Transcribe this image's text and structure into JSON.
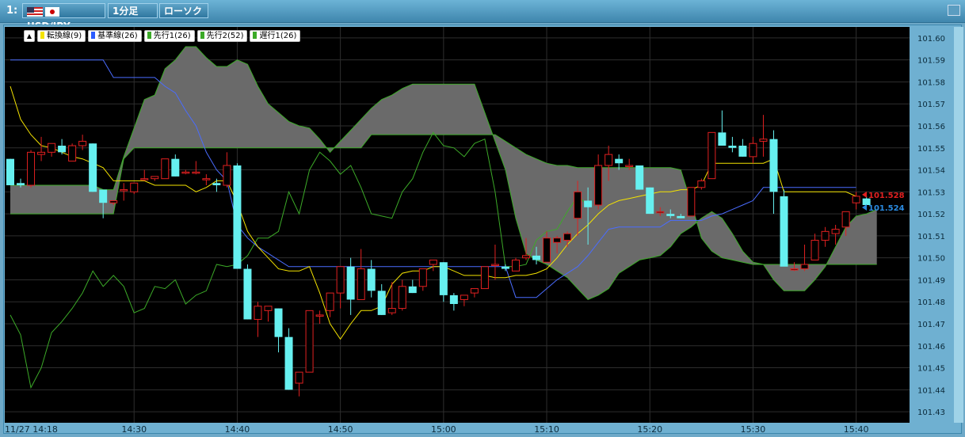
{
  "window": {
    "number": "1:",
    "pair": "USD/JPY",
    "timeframe": "1分足",
    "chart_type": "ローソク"
  },
  "legend": {
    "toggle": "▲",
    "items": [
      {
        "label": "転換線(9)",
        "color": "#f4e300"
      },
      {
        "label": "基準線(26)",
        "color": "#2b5cff"
      },
      {
        "label": "先行1(26)",
        "color": "#3caa28"
      },
      {
        "label": "先行2(52)",
        "color": "#3caa28"
      },
      {
        "label": "遅行1(26)",
        "color": "#3caa28"
      }
    ]
  },
  "chart_data": {
    "type": "candlestick",
    "title": "",
    "ylim": [
      101.425,
      101.605
    ],
    "y_ticks": [
      "101.60",
      "101.59",
      "101.58",
      "101.57",
      "101.56",
      "101.55",
      "101.54",
      "101.53",
      "101.52",
      "101.51",
      "101.50",
      "101.49",
      "101.48",
      "101.47",
      "101.46",
      "101.45",
      "101.44",
      "101.43"
    ],
    "x_ticks": [
      {
        "label": "11/27 14:18",
        "index": 0
      },
      {
        "label": "14:30",
        "index": 12
      },
      {
        "label": "14:40",
        "index": 22
      },
      {
        "label": "14:50",
        "index": 32
      },
      {
        "label": "15:00",
        "index": 42
      },
      {
        "label": "15:10",
        "index": 52
      },
      {
        "label": "15:20",
        "index": 62
      },
      {
        "label": "15:30",
        "index": 72
      },
      {
        "label": "15:40",
        "index": 82
      }
    ],
    "colors": {
      "background": "#000000",
      "grid": "#2e2e2e",
      "bull": "#e02020",
      "bear": "#66f0f0",
      "cloud": "#6a6a6a"
    },
    "price_labels": [
      {
        "value": 101.528,
        "text": "101.528",
        "color": "#e02020"
      },
      {
        "value": 101.524,
        "text": "101.524",
        "color": "#2a8ae0"
      }
    ],
    "candles": [
      [
        101.545,
        101.545,
        101.533,
        101.533
      ],
      [
        101.534,
        101.536,
        101.532,
        101.533
      ],
      [
        101.533,
        101.549,
        101.532,
        101.548
      ],
      [
        101.547,
        101.555,
        101.544,
        101.548
      ],
      [
        101.548,
        101.552,
        101.546,
        101.552
      ],
      [
        101.551,
        101.554,
        101.547,
        101.548
      ],
      [
        101.544,
        101.552,
        101.544,
        101.551
      ],
      [
        101.551,
        101.556,
        101.549,
        101.553
      ],
      [
        101.552,
        101.552,
        101.53,
        101.53
      ],
      [
        101.531,
        101.531,
        101.518,
        101.525
      ],
      [
        101.525,
        101.526,
        101.524,
        101.526
      ],
      [
        101.531,
        101.534,
        101.526,
        101.531
      ],
      [
        101.53,
        101.534,
        101.529,
        101.534
      ],
      [
        101.536,
        101.54,
        101.535,
        101.536
      ],
      [
        101.536,
        101.537,
        101.535,
        101.537
      ],
      [
        101.536,
        101.545,
        101.536,
        101.545
      ],
      [
        101.545,
        101.547,
        101.537,
        101.537
      ],
      [
        101.539,
        101.54,
        101.538,
        101.539
      ],
      [
        101.539,
        101.544,
        101.538,
        101.539
      ],
      [
        101.536,
        101.538,
        101.533,
        101.536
      ],
      [
        101.534,
        101.536,
        101.53,
        101.533
      ],
      [
        101.533,
        101.548,
        101.532,
        101.542
      ],
      [
        101.542,
        101.543,
        101.495,
        101.495
      ],
      [
        101.495,
        101.497,
        101.472,
        101.472
      ],
      [
        101.472,
        101.48,
        101.464,
        101.478
      ],
      [
        101.476,
        101.478,
        101.471,
        101.478
      ],
      [
        101.477,
        101.477,
        101.457,
        101.464
      ],
      [
        101.464,
        101.468,
        101.44,
        101.44
      ],
      [
        101.443,
        101.446,
        101.437,
        101.448
      ],
      [
        101.448,
        101.452,
        101.448,
        101.476
      ],
      [
        101.474,
        101.476,
        101.47,
        101.474
      ],
      [
        101.476,
        101.482,
        101.473,
        101.484
      ],
      [
        101.484,
        101.496,
        101.477,
        101.496
      ],
      [
        101.496,
        101.5,
        101.474,
        101.481
      ],
      [
        101.481,
        101.504,
        101.481,
        101.495
      ],
      [
        101.495,
        101.499,
        101.482,
        101.485
      ],
      [
        101.485,
        101.488,
        101.474,
        101.474
      ],
      [
        101.475,
        101.489,
        101.474,
        101.477
      ],
      [
        101.477,
        101.49,
        101.476,
        101.487
      ],
      [
        101.487,
        101.49,
        101.484,
        101.484
      ],
      [
        101.487,
        101.492,
        101.485,
        101.495
      ],
      [
        101.497,
        101.499,
        101.494,
        101.499
      ],
      [
        101.498,
        101.498,
        101.48,
        101.483
      ],
      [
        101.483,
        101.484,
        101.476,
        101.479
      ],
      [
        101.481,
        101.482,
        101.478,
        101.483
      ],
      [
        101.484,
        101.486,
        101.482,
        101.486
      ],
      [
        101.486,
        101.486,
        101.496,
        101.496
      ],
      [
        101.497,
        101.506,
        101.49,
        101.497
      ],
      [
        101.496,
        101.497,
        101.494,
        101.495
      ],
      [
        101.494,
        101.5,
        101.494,
        101.499
      ],
      [
        101.5,
        101.509,
        101.499,
        101.501
      ],
      [
        101.501,
        101.505,
        101.497,
        101.499
      ],
      [
        101.498,
        101.512,
        101.499,
        101.509
      ],
      [
        101.507,
        101.51,
        101.502,
        101.509
      ],
      [
        101.508,
        101.512,
        101.505,
        101.511
      ],
      [
        101.518,
        101.535,
        101.51,
        101.53
      ],
      [
        101.526,
        101.532,
        101.506,
        101.523
      ],
      [
        101.524,
        101.547,
        101.522,
        101.542
      ],
      [
        101.542,
        101.551,
        101.535,
        101.547
      ],
      [
        101.545,
        101.547,
        101.54,
        101.543
      ],
      [
        101.542,
        101.545,
        101.54,
        101.542
      ],
      [
        101.542,
        101.542,
        101.531,
        101.531
      ],
      [
        101.532,
        101.532,
        101.52,
        101.52
      ],
      [
        101.521,
        101.523,
        101.519,
        101.521
      ],
      [
        101.52,
        101.522,
        101.518,
        101.519
      ],
      [
        101.519,
        101.52,
        101.518,
        101.518
      ],
      [
        101.519,
        101.532,
        101.519,
        101.532
      ],
      [
        101.532,
        101.536,
        101.531,
        101.535
      ],
      [
        101.536,
        101.548,
        101.536,
        101.557
      ],
      [
        101.557,
        101.567,
        101.557,
        101.551
      ],
      [
        101.551,
        101.555,
        101.548,
        101.55
      ],
      [
        101.551,
        101.554,
        101.546,
        101.546
      ],
      [
        101.546,
        101.555,
        101.543,
        101.552
      ],
      [
        101.553,
        101.565,
        101.546,
        101.554
      ],
      [
        101.554,
        101.558,
        101.52,
        101.53
      ],
      [
        101.528,
        101.531,
        101.503,
        101.496
      ],
      [
        101.495,
        101.498,
        101.494,
        101.495
      ],
      [
        101.495,
        101.506,
        101.494,
        101.497
      ],
      [
        101.499,
        101.511,
        101.499,
        101.508
      ],
      [
        101.508,
        101.514,
        101.505,
        101.512
      ],
      [
        101.511,
        101.515,
        101.506,
        101.513
      ],
      [
        101.514,
        101.519,
        101.51,
        101.521
      ],
      [
        101.525,
        101.53,
        101.522,
        101.528
      ],
      [
        101.527,
        101.528,
        101.524,
        101.524
      ]
    ],
    "tenkan": [
      101.578,
      101.563,
      101.556,
      101.551,
      101.55,
      101.548,
      101.546,
      101.545,
      101.543,
      101.541,
      101.535,
      101.535,
      101.535,
      101.535,
      101.533,
      101.533,
      101.533,
      101.533,
      101.53,
      101.532,
      101.535,
      101.535,
      101.525,
      101.512,
      101.505,
      101.5,
      101.495,
      101.494,
      101.494,
      101.496,
      101.484,
      101.47,
      101.463,
      101.47,
      101.476,
      101.476,
      101.478,
      101.488,
      101.493,
      101.494,
      101.494,
      101.496,
      101.496,
      101.494,
      101.492,
      101.492,
      101.492,
      101.491,
      101.491,
      101.492,
      101.492,
      101.493,
      101.495,
      101.5,
      101.506,
      101.511,
      101.515,
      101.52,
      101.524,
      101.526,
      101.527,
      101.528,
      101.529,
      101.53,
      101.53,
      101.531,
      101.531,
      101.533,
      101.543,
      101.543,
      101.543,
      101.543,
      101.543,
      101.543,
      101.545,
      101.53,
      101.53,
      101.53,
      101.53,
      101.53,
      101.53,
      101.53,
      101.528
    ],
    "kijun": [
      101.59,
      101.59,
      101.59,
      101.59,
      101.59,
      101.59,
      101.59,
      101.59,
      101.59,
      101.59,
      101.582,
      101.582,
      101.582,
      101.582,
      101.582,
      101.578,
      101.575,
      101.567,
      101.56,
      101.548,
      101.54,
      101.535,
      101.515,
      101.509,
      101.505,
      101.502,
      101.499,
      101.496,
      101.496,
      101.496,
      101.496,
      101.496,
      101.496,
      101.496,
      101.496,
      101.496,
      101.496,
      101.496,
      101.496,
      101.496,
      101.496,
      101.496,
      101.496,
      101.496,
      101.496,
      101.496,
      101.496,
      101.496,
      101.496,
      101.482,
      101.482,
      101.482,
      101.486,
      101.49,
      101.493,
      101.496,
      101.501,
      101.507,
      101.513,
      101.514,
      101.514,
      101.514,
      101.514,
      101.514,
      101.517,
      101.517,
      101.517,
      101.517,
      101.519,
      101.52,
      101.522,
      101.524,
      101.526,
      101.532,
      101.532,
      101.532,
      101.532,
      101.532,
      101.532,
      101.532,
      101.532,
      101.532,
      101.532
    ],
    "senkou1": [
      101.533,
      101.533,
      101.533,
      101.533,
      101.533,
      101.533,
      101.533,
      101.533,
      101.533,
      101.531,
      101.531,
      101.546,
      101.559,
      101.572,
      101.574,
      101.586,
      101.59,
      101.596,
      101.596,
      101.591,
      101.587,
      101.587,
      101.59,
      101.588,
      101.578,
      101.57,
      101.566,
      101.562,
      101.56,
      101.559,
      101.554,
      101.548,
      101.553,
      101.558,
      101.563,
      101.568,
      101.572,
      101.574,
      101.577,
      101.579,
      101.579,
      101.579,
      101.579,
      101.579,
      101.579,
      101.579,
      101.566,
      101.553,
      101.54,
      101.518,
      101.502,
      101.499,
      101.497,
      101.494,
      101.491,
      101.486,
      101.481,
      101.483,
      101.486,
      101.493,
      101.496,
      101.499,
      101.5,
      101.501,
      101.505,
      101.511,
      101.514,
      101.518,
      101.521,
      101.518,
      101.511,
      101.503,
      101.498,
      101.497,
      101.49,
      101.485,
      101.485,
      101.485,
      101.49,
      101.496,
      101.505,
      101.514,
      101.519,
      101.52,
      101.522
    ],
    "senkou2": [
      101.52,
      101.52,
      101.52,
      101.52,
      101.52,
      101.52,
      101.52,
      101.52,
      101.52,
      101.52,
      101.52,
      101.545,
      101.55,
      101.55,
      101.55,
      101.55,
      101.55,
      101.55,
      101.55,
      101.55,
      101.55,
      101.55,
      101.55,
      101.55,
      101.55,
      101.55,
      101.55,
      101.55,
      101.55,
      101.55,
      101.55,
      101.55,
      101.55,
      101.55,
      101.55,
      101.556,
      101.556,
      101.556,
      101.556,
      101.556,
      101.556,
      101.556,
      101.556,
      101.556,
      101.556,
      101.556,
      101.556,
      101.556,
      101.553,
      101.55,
      101.547,
      101.545,
      101.543,
      101.542,
      101.542,
      101.541,
      101.541,
      101.541,
      101.541,
      101.541,
      101.541,
      101.541,
      101.541,
      101.541,
      101.541,
      101.54,
      101.525,
      101.509,
      101.503,
      101.5,
      101.499,
      101.498,
      101.497,
      101.497,
      101.497,
      101.497,
      101.497,
      101.497,
      101.497,
      101.497,
      101.497,
      101.497,
      101.497,
      101.497,
      101.497
    ],
    "chikou": [
      101.474,
      101.465,
      101.441,
      101.45,
      101.466,
      101.471,
      101.477,
      101.484,
      101.494,
      101.487,
      101.492,
      101.487,
      101.475,
      101.477,
      101.487,
      101.486,
      101.49,
      101.479,
      101.483,
      101.485,
      101.497,
      101.496,
      101.497,
      101.501,
      101.509,
      101.509,
      101.512,
      101.53,
      101.52,
      101.54,
      101.548,
      101.544,
      101.538,
      101.542,
      101.532,
      101.52,
      101.519,
      101.518,
      101.53,
      101.536,
      101.548,
      101.557,
      101.551,
      101.55,
      101.546,
      101.552,
      101.554,
      101.53,
      101.496,
      101.496,
      101.497,
      101.508,
      101.512,
      101.513,
      101.521,
      101.528,
      101.524
    ]
  }
}
